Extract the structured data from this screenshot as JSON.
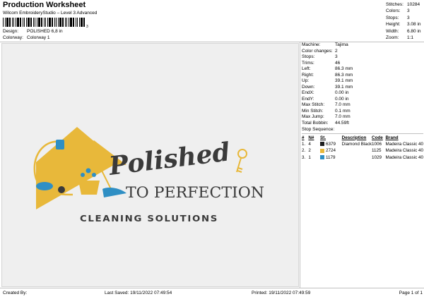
{
  "header": {
    "title": "Production Worksheet",
    "subtitle": "Wilcom EmbroideryStudio – Level 3 Advanced",
    "barcode_text": "3",
    "design_label": "Design:",
    "design_value": "POLISHED 6,8 in",
    "colorway_label": "Colorway:",
    "colorway_value": "Colorway 1"
  },
  "stats": [
    {
      "label": "Stitches:",
      "value": "10284"
    },
    {
      "label": "Colors:",
      "value": "3"
    },
    {
      "label": "Stops:",
      "value": "3"
    },
    {
      "label": "Height:",
      "value": "3.08 in"
    },
    {
      "label": "Width:",
      "value": "6.80 in"
    },
    {
      "label": "Zoom:",
      "value": "1:1"
    }
  ],
  "machine": [
    {
      "label": "Machine:",
      "value": "Tajima"
    },
    {
      "label": "Color changes:",
      "value": "2"
    },
    {
      "label": "Stops:",
      "value": "3"
    },
    {
      "label": "Trims:",
      "value": "46"
    },
    {
      "label": "Left:",
      "value": "86.3 mm"
    },
    {
      "label": "Right:",
      "value": "86.3 mm"
    },
    {
      "label": "Up:",
      "value": "39.1 mm"
    },
    {
      "label": "Down:",
      "value": "39.1 mm"
    },
    {
      "label": "EndX:",
      "value": "0.00 in"
    },
    {
      "label": "EndY:",
      "value": "0.00 in"
    },
    {
      "label": "Max Stitch:",
      "value": "7.0 mm"
    },
    {
      "label": "Min Stitch:",
      "value": "0.1 mm"
    },
    {
      "label": "Max Jump:",
      "value": "7.0 mm"
    },
    {
      "label": "Total Bobbin:",
      "value": "44.59ft"
    }
  ],
  "stop_sequence": {
    "label": "Stop Sequence:",
    "columns": [
      "#",
      "N#",
      "St.",
      "Description",
      "Code",
      "Brand"
    ],
    "rows": [
      {
        "num": "1.",
        "n": "4",
        "color": "#1e1e1e",
        "st": "6379",
        "desc": "Diamond Black",
        "code": "1006",
        "brand": "Madeira Classic 40"
      },
      {
        "num": "2.",
        "n": "2",
        "color": "#e8b83a",
        "st": "2724",
        "desc": "",
        "code": "1125",
        "brand": "Madeira Classic 40"
      },
      {
        "num": "3.",
        "n": "1",
        "color": "#2f8fc4",
        "st": "1179",
        "desc": "",
        "code": "1029",
        "brand": "Madeira Classic 40"
      }
    ]
  },
  "design_text": {
    "script": "Polished",
    "tagline": "TO PERFECTION",
    "sub": "CLEANING SOLUTIONS"
  },
  "colors": {
    "gold": "#e8b83a",
    "dark": "#3a3a3a",
    "blue": "#2f8fc4",
    "canvas": "#efefef"
  },
  "footer": {
    "created_by": "Created By:",
    "last_saved": "Last Saved: 19/11/2022 07:49:54",
    "printed": "Printed: 19/11/2022 07:49:59",
    "page": "Page 1 of 1"
  }
}
